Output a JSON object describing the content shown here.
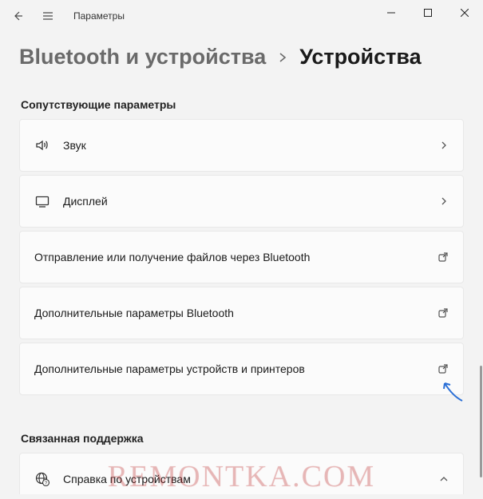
{
  "titlebar": {
    "app_title": "Параметры"
  },
  "breadcrumb": {
    "parent": "Bluetooth и устройства",
    "current": "Устройства"
  },
  "sections": {
    "related": {
      "header": "Сопутствующие параметры",
      "items": {
        "sound": "Звук",
        "display": "Дисплей",
        "bt_files": "Отправление или получение файлов через Bluetooth",
        "bt_advanced": "Дополнительные параметры Bluetooth",
        "devices_printers": "Дополнительные параметры устройств и принтеров"
      }
    },
    "support": {
      "header": "Связанная поддержка",
      "items": {
        "help_devices": "Справка по устройствам"
      }
    }
  },
  "watermark": "REMONTKA.COM"
}
